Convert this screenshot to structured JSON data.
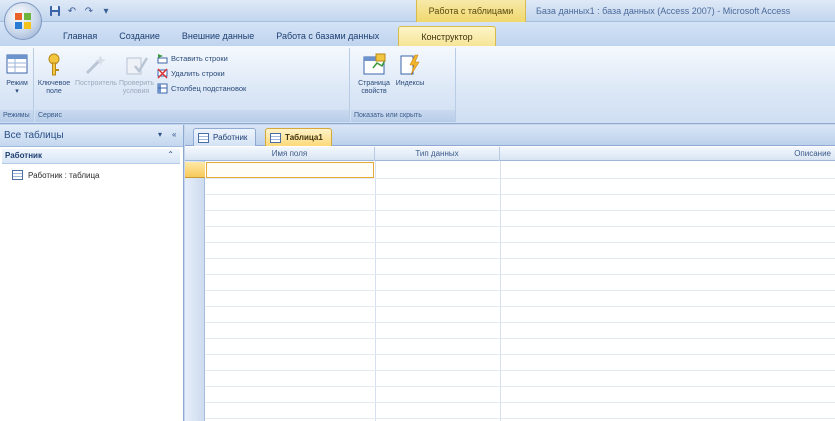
{
  "titlebar": {
    "context_title": "Работа с таблицами",
    "window_title": "База данных1 : база данных (Access 2007) - Microsoft Access"
  },
  "tabs": [
    "Главная",
    "Создание",
    "Внешние данные",
    "Работа с базами данных",
    "Конструктор"
  ],
  "ribbon": {
    "groups": {
      "views": "Режимы",
      "tools": "Сервис",
      "show_hide": "Показать или скрыть"
    },
    "views_mode": "Режим",
    "primary_key": "Ключевое поле",
    "builder": "Построитель",
    "test_rules": "Проверить условия",
    "insert_rows": "Вставить строки",
    "delete_rows": "Удалить строки",
    "lookup_column": "Столбец подстановок",
    "property_sheet": "Страница свойств",
    "indexes": "Индексы"
  },
  "nav": {
    "title": "Все таблицы",
    "group": "Работник",
    "items": [
      "Работник : таблица"
    ]
  },
  "doc_tabs": [
    "Работник",
    "Таблица1"
  ],
  "design_grid": {
    "columns": [
      "Имя поля",
      "Тип данных",
      "Описание"
    ]
  },
  "colors": {
    "ribbon_blue": "#bfd4ee",
    "context_yellow": "#f0d86c",
    "active_orange": "#e5a937"
  }
}
